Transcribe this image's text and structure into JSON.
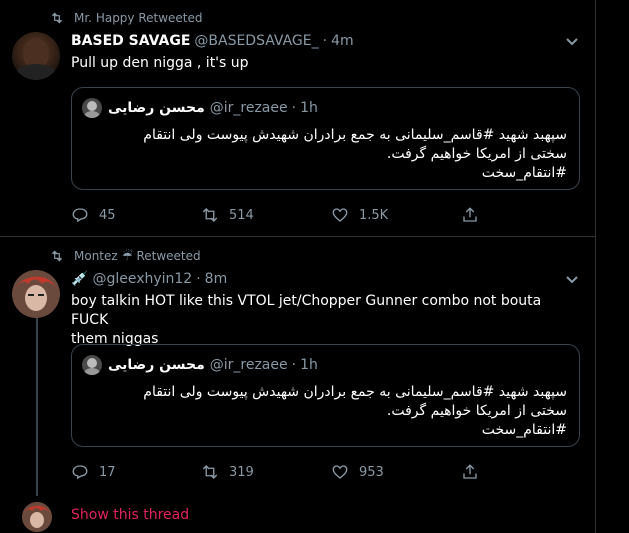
{
  "tweets": [
    {
      "retweeted_by": "Mr. Happy Retweeted",
      "name": "BASED SAVAGE",
      "handle": "@BASEDSAVAGE_",
      "time": "4m",
      "text": "Pull up den nigga , it's up",
      "quote": {
        "name": "محسن رضایی",
        "handle": "@ir_rezaee",
        "time": "1h",
        "lines": [
          "سپهبد شهید #قاسم_سلیمانی به جمع برادران شهیدش پیوست ولی انتقام",
          "سختی از امریکا خواهیم گرفت.",
          "#انتقام_سخت"
        ]
      },
      "replies": "45",
      "retweets": "514",
      "likes": "1.5K"
    },
    {
      "retweeted_by": "Montez",
      "retweeted_suffix": "Retweeted",
      "emoji": "☔",
      "name_emoji": "💉",
      "handle": "@gleexhyin12",
      "time": "8m",
      "text_line1": "boy talkin HOT like this VTOL jet/Chopper Gunner combo not bouta FUCK",
      "text_line2": "them niggas",
      "quote": {
        "name": "محسن رضایی",
        "handle": "@ir_rezaee",
        "time": "1h",
        "lines": [
          "سپهبد شهید #قاسم_سلیمانی به جمع برادران شهیدش پیوست ولی انتقام",
          "سختی از امریکا خواهیم گرفت.",
          "#انتقام_سخت"
        ]
      },
      "replies": "17",
      "retweets": "319",
      "likes": "953"
    }
  ],
  "show_thread": "Show this thread",
  "colors": {
    "accent_red": "#e0245e",
    "muted": "#8899a6",
    "border": "#38444d"
  }
}
